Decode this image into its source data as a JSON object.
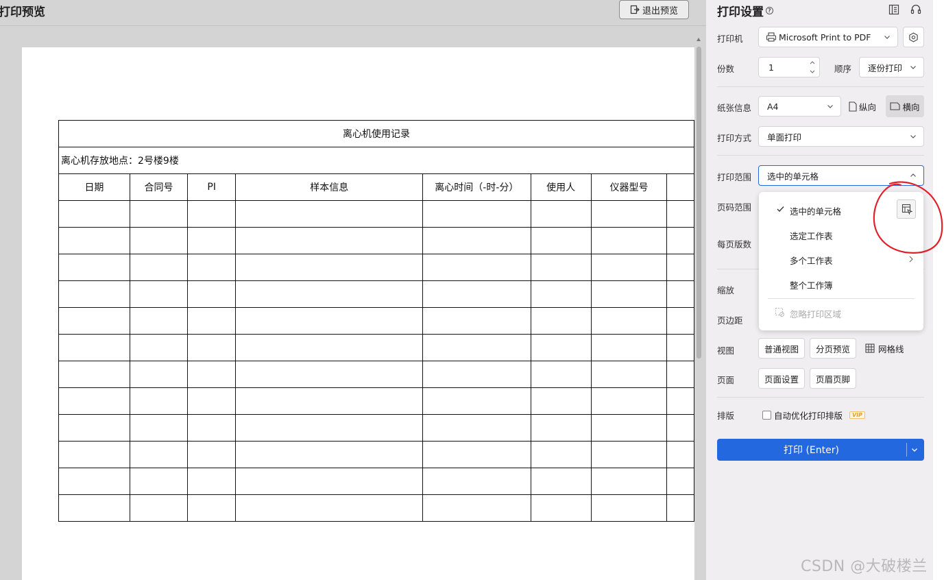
{
  "preview": {
    "title": "打印预览",
    "exit_label": "退出预览"
  },
  "sheet": {
    "title": "离心机使用记录",
    "location": "离心机存放地点：2号楼9楼",
    "headers": [
      "日期",
      "合同号",
      "PI",
      "样本信息",
      "离心时间（-时-分）",
      "使用人",
      "仪器型号",
      ""
    ],
    "empty_rows": 12
  },
  "settings": {
    "title": "打印设置",
    "printer_label": "打印机",
    "printer_value": "Microsoft Print to PDF",
    "copies_label": "份数",
    "copies_value": "1",
    "order_label": "顺序",
    "order_value": "逐份打印",
    "paper_label": "纸张信息",
    "paper_value": "A4",
    "portrait_label": "纵向",
    "landscape_label": "横向",
    "print_mode_label": "打印方式",
    "print_mode_value": "单面打印",
    "range_label": "打印范围",
    "range_value": "选中的单元格",
    "page_range_label": "页码范围",
    "pages_per_sheet_label": "每页版数",
    "scale_label": "缩放",
    "margin_label": "页边距",
    "view_label": "视图",
    "normal_view": "普通视图",
    "page_break_view": "分页预览",
    "gridlines": "网格线",
    "page_label": "页面",
    "page_setup": "页面设置",
    "header_footer": "页眉页脚",
    "layout_label": "排版",
    "auto_optimize": "自动优化打印排版",
    "vip": "VIP",
    "print_button": "打印 (Enter)"
  },
  "dropdown": {
    "items": [
      "选中的单元格",
      "选定工作表",
      "多个工作表",
      "整个工作簿"
    ],
    "disabled_item": "忽略打印区域"
  },
  "colors": {
    "accent": "#2468e0",
    "annotation": "#e0202a"
  },
  "watermark": "CSDN @大破楼兰"
}
